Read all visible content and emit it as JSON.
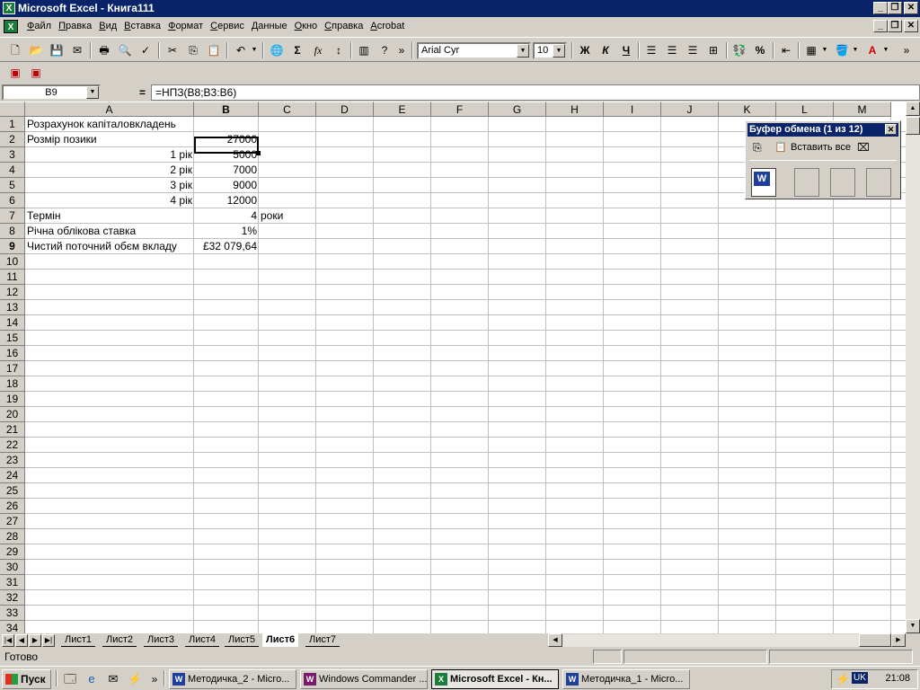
{
  "window": {
    "title": "Microsoft Excel - Книга111",
    "minimize_glyph": "_",
    "restore_glyph": "❐",
    "close_glyph": "✕"
  },
  "menubar": {
    "items": [
      "Файл",
      "Правка",
      "Вид",
      "Вставка",
      "Формат",
      "Сервис",
      "Данные",
      "Окно",
      "Справка",
      "Acrobat"
    ]
  },
  "toolbar": {
    "font_name": "Arial Cyr",
    "font_size": "10",
    "bold_label": "Ж",
    "italic_label": "К",
    "underline_label": "Ч",
    "sum_label": "Σ",
    "fx_label": "fx",
    "percent_label": "%"
  },
  "formula_bar": {
    "name_box": "B9",
    "equals": "=",
    "formula": "=НПЗ(B8;B3:B6)"
  },
  "sheet": {
    "columns": [
      "A",
      "B",
      "C",
      "D",
      "E",
      "F",
      "G",
      "H",
      "I",
      "J",
      "K",
      "L",
      "M"
    ],
    "rows": [
      "1",
      "2",
      "3",
      "4",
      "5",
      "6",
      "7",
      "8",
      "9",
      "10",
      "11",
      "12",
      "13",
      "14",
      "15",
      "16",
      "17",
      "18",
      "19",
      "20",
      "21",
      "22",
      "23",
      "24",
      "25",
      "26",
      "27",
      "28",
      "29",
      "30",
      "31",
      "32",
      "33",
      "34"
    ],
    "cells": {
      "A1": "Розрахунок капіталовкладень",
      "A2": "Розмір позики",
      "B2": "27000",
      "A3": "1 рік",
      "B3": "5000",
      "A4": "2 рік",
      "B4": "7000",
      "A5": "3 рік",
      "B5": "9000",
      "A6": "4 рік",
      "B6": "12000",
      "A7": "Термін",
      "B7": "4",
      "C7": "роки",
      "A8": "Річна облікова ставка",
      "B8": "1%",
      "A9": "Чистий поточний обєм вкладу",
      "B9": "£32 079,64"
    },
    "selected_cell": "B9"
  },
  "sheet_tabs": [
    "Лист1",
    "Лист2",
    "Лист3",
    "Лист4",
    "Лист5",
    "Лист6",
    "Лист7"
  ],
  "active_tab": "Лист6",
  "status": {
    "text": "Готово"
  },
  "clipboard": {
    "title": "Буфер обмена (1 из 12)",
    "paste_all": "Вставить все"
  },
  "taskbar": {
    "start": "Пуск",
    "tasks": [
      {
        "label": "Методичка_2 - Micro...",
        "icon": "word-icon"
      },
      {
        "label": "Windows Commander ...",
        "icon": "commander-icon"
      },
      {
        "label": "Microsoft Excel - Кн...",
        "icon": "excel-icon"
      },
      {
        "label": "Методичка_1 - Micro...",
        "icon": "word-icon"
      }
    ],
    "language": "UK",
    "clock": "21:08"
  }
}
